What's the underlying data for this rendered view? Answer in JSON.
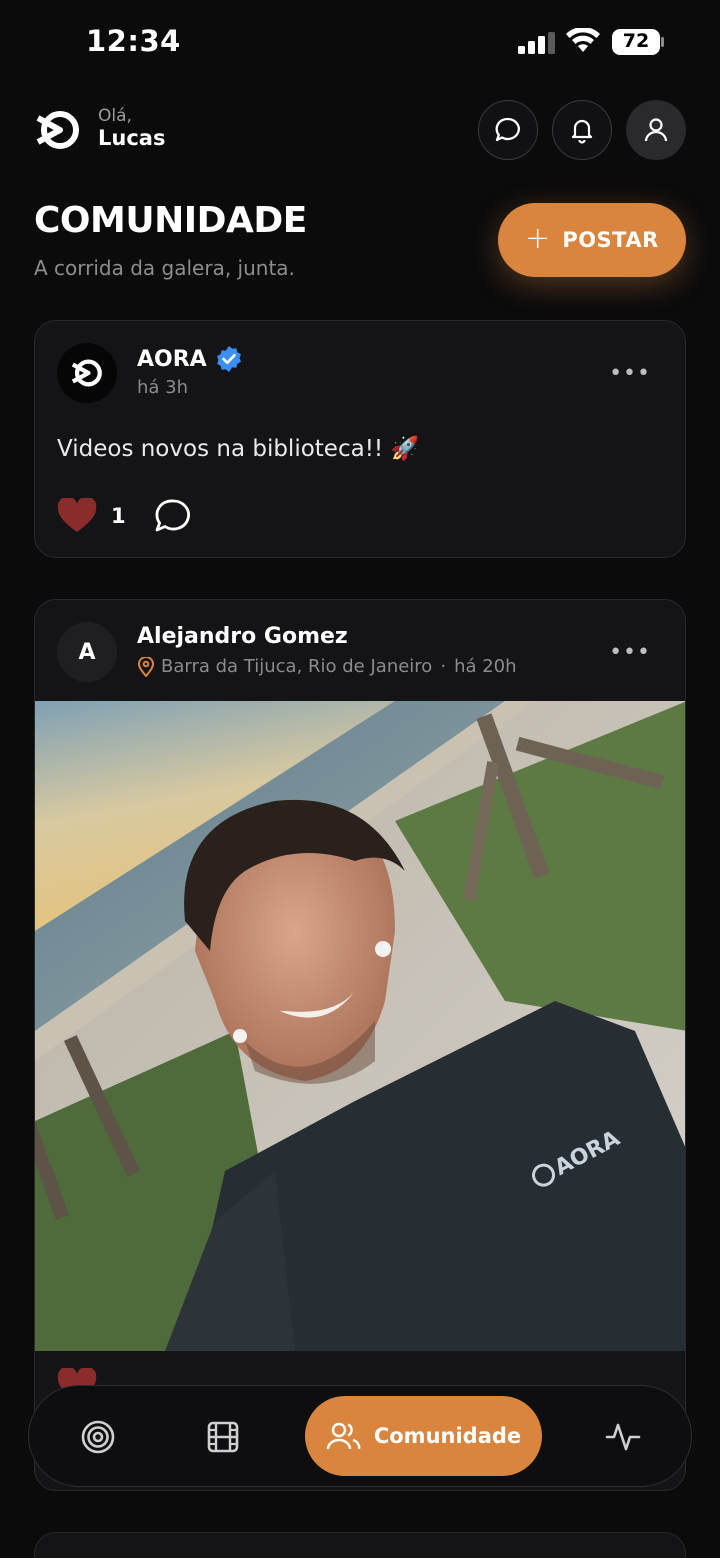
{
  "status_bar": {
    "time": "12:34",
    "battery": "72"
  },
  "header": {
    "greeting": "Olá,",
    "user_name": "Lucas"
  },
  "page": {
    "title": "COMUNIDADE",
    "subtitle": "A corrida da galera, junta.",
    "post_button": "POSTAR"
  },
  "posts": [
    {
      "author": "AORA",
      "verified": true,
      "time": "há 3h",
      "text": "Videos novos na biblioteca!! 🚀",
      "likes": "1"
    },
    {
      "author": "Alejandro Gomez",
      "avatar_letter": "A",
      "location": "Barra da Tijuca, Rio de Janeiro",
      "separator": "·",
      "time": "há 20h"
    }
  ],
  "nav": {
    "active_label": "Comunidade"
  },
  "colors": {
    "accent": "#d9853e",
    "background": "#0b0b0c",
    "card": "#141416",
    "verified": "#3b8ff0",
    "like": "#8b2c2c"
  }
}
